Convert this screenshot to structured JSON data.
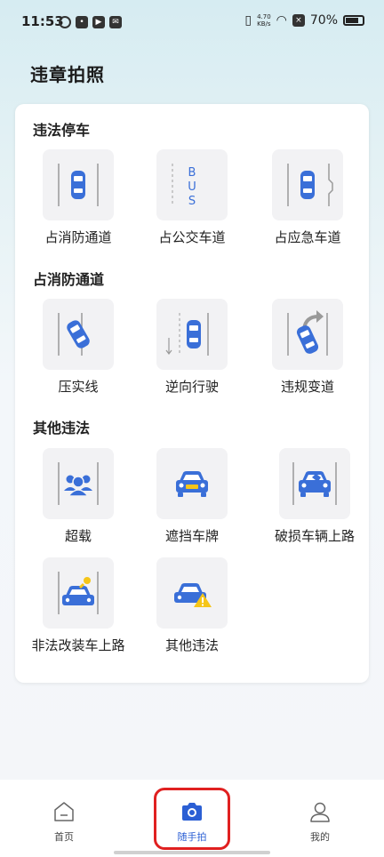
{
  "status_bar": {
    "time": "11:53",
    "speed_value": "4.70",
    "speed_unit": "KB/s",
    "battery": "70%"
  },
  "page": {
    "title": "违章拍照"
  },
  "sections": [
    {
      "title": "违法停车",
      "items": [
        {
          "label": "占消防通道",
          "icon": "car-between-lanes-icon"
        },
        {
          "label": "占公交车道",
          "icon": "bus-lane-icon",
          "icon_text": [
            "B",
            "U",
            "S"
          ]
        },
        {
          "label": "占应急车道",
          "icon": "emergency-lane-icon"
        }
      ]
    },
    {
      "title": "占消防通道",
      "items": [
        {
          "label": "压实线",
          "icon": "car-on-solid-line-icon"
        },
        {
          "label": "逆向行驶",
          "icon": "wrong-way-icon"
        },
        {
          "label": "违规变道",
          "icon": "illegal-lane-change-icon"
        }
      ]
    },
    {
      "title": "其他违法",
      "items": [
        {
          "label": "超载",
          "icon": "overload-people-icon"
        },
        {
          "label": "遮挡车牌",
          "icon": "covered-plate-icon"
        },
        {
          "label": "破损车辆上路",
          "icon": "damaged-car-icon"
        },
        {
          "label": "非法改装车上路",
          "icon": "modified-car-icon"
        },
        {
          "label": "其他违法",
          "icon": "other-violation-icon"
        }
      ]
    }
  ],
  "tabbar": {
    "tabs": [
      {
        "label": "首页",
        "icon": "home-icon"
      },
      {
        "label": "随手拍",
        "icon": "camera-icon",
        "active": true
      },
      {
        "label": "我的",
        "icon": "user-icon"
      }
    ]
  },
  "colors": {
    "accent": "#2b5fd4",
    "icon_blue": "#3a6fd8",
    "highlight": "#e02020",
    "warning": "#f5c518"
  }
}
